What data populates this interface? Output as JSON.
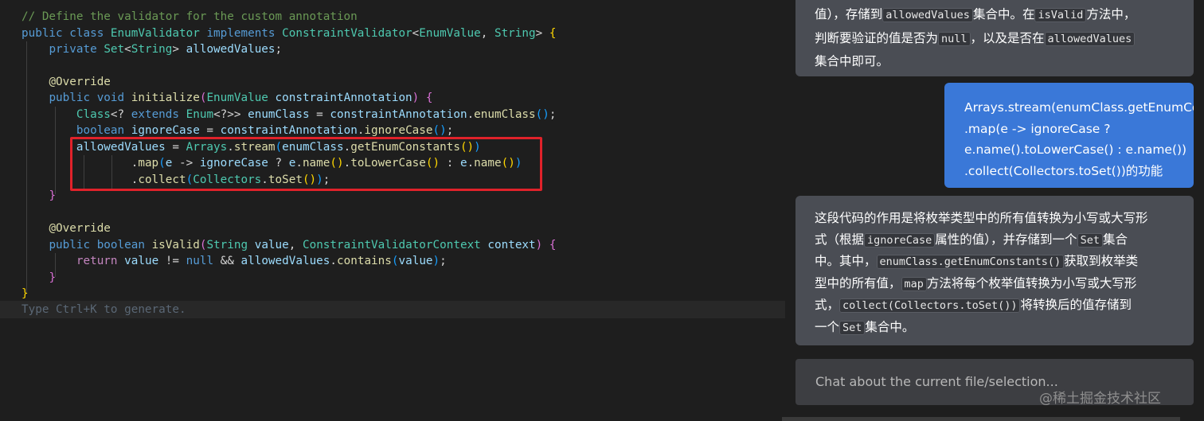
{
  "editor": {
    "line_comment": "// Define the validator for the custom annotation",
    "hint": "Type Ctrl+K to generate.",
    "tok": {
      "public": "public",
      "class": "class",
      "EnumValidator": "EnumValidator",
      "implements": "implements",
      "ConstraintValidator": "ConstraintValidator",
      "EnumValue": "EnumValue",
      "String": "String",
      "private": "private",
      "Set": "Set",
      "allowedValues": "allowedValues",
      "Override": "@Override",
      "void": "void",
      "initialize": "initialize",
      "constraintAnnotation": "constraintAnnotation",
      "Class": "Class",
      "extends": "extends",
      "Enum": "Enum",
      "enumClass": "enumClass",
      "boolean": "boolean",
      "ignoreCase": "ignoreCase",
      "Arrays": "Arrays",
      "stream": "stream",
      "getEnumConstants": "getEnumConstants",
      "map": "map",
      "e": "e",
      "name": "name",
      "toLowerCase": "toLowerCase",
      "collect": "collect",
      "Collectors": "Collectors",
      "toSet": "toSet",
      "isValid": "isValid",
      "value": "value",
      "ConstraintValidatorContext": "ConstraintValidatorContext",
      "context": "context",
      "return": "return",
      "null": "null",
      "contains": "contains"
    }
  },
  "chat": {
    "msg1": {
      "t1": "值），存储到",
      "c1": "allowedValues",
      "t2": "集合中。在",
      "c2": "isValid",
      "t3": "方法中，",
      "t4": "判断要验证的值是否为",
      "c3": "null",
      "t5": "，以及是否在",
      "c4": "allowedValues",
      "t6": "集合中即可。"
    },
    "user_msg": {
      "l1": "Arrays.stream(enumClass.getEnumConsta",
      "l2": ".map(e -> ignoreCase ?",
      "l3": "e.name().toLowerCase() : e.name())",
      "l4": ".collect(Collectors.toSet())的功能"
    },
    "msg2": {
      "t1": "这段代码的作用是将枚举类型中的所有值转换为小写或大写形",
      "t2": "式（根据",
      "c1": "ignoreCase",
      "t3": "属性的值），并存储到一个",
      "c2": "Set",
      "t4": "集合",
      "t5": "中。其中，",
      "c3": "enumClass.getEnumConstants()",
      "t6": "获取到枚举类",
      "t7": "型中的所有值，",
      "c4": "map",
      "t8": "方法将每个枚举值转换为小写或大写形",
      "t9": "式，",
      "c5": "collect(Collectors.toSet())",
      "t10": "将转换后的值存储到",
      "t11": "一个",
      "c6": "Set",
      "t12": "集合中。"
    },
    "input_placeholder": "Chat about the current file/selection...",
    "watermark": "@稀土掘金技术社区"
  },
  "colors": {
    "editor_bg": "#1e1e1e",
    "highlight_box": "#e0222a",
    "ai_bubble": "#4a4d54",
    "user_bubble": "#3a78d8"
  }
}
